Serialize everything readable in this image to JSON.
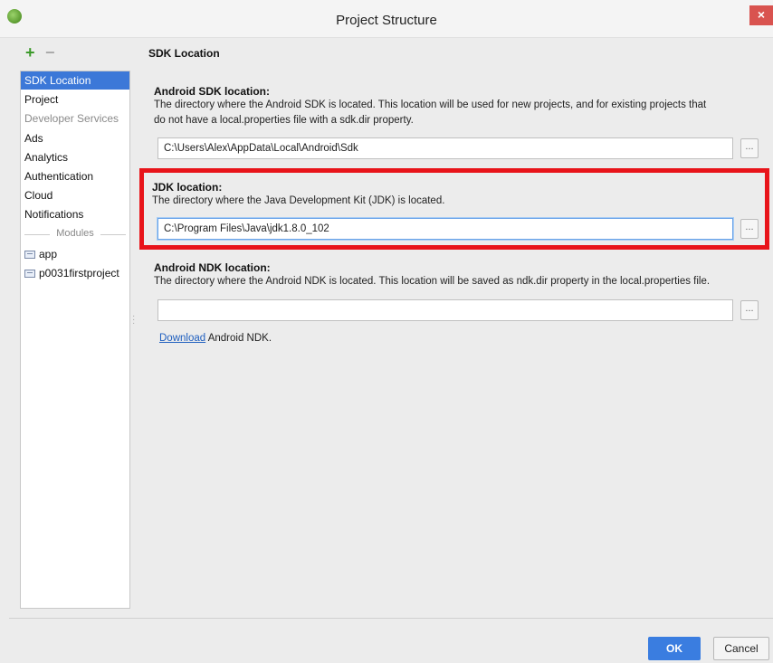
{
  "window": {
    "title": "Project Structure",
    "close_label": "×"
  },
  "toolbar": {
    "add_label": "+",
    "remove_label": "−"
  },
  "sidebar": {
    "items": [
      {
        "label": "SDK Location",
        "selected": true
      },
      {
        "label": "Project"
      },
      {
        "label": "Developer Services",
        "disabled": true
      },
      {
        "label": "Ads"
      },
      {
        "label": "Analytics"
      },
      {
        "label": "Authentication"
      },
      {
        "label": "Cloud"
      },
      {
        "label": "Notifications"
      }
    ],
    "modules_label": "Modules",
    "modules": [
      {
        "label": "app"
      },
      {
        "label": "p0031firstproject"
      }
    ]
  },
  "main": {
    "heading": "SDK Location",
    "android_sdk": {
      "title": "Android SDK location:",
      "description_line1": "The directory where the Android SDK is located. This location will be used for new projects, and for existing projects that",
      "description_line2": "do not have a local.properties file with a sdk.dir property.",
      "value": "C:\\Users\\Alex\\AppData\\Local\\Android\\Sdk",
      "browse_label": "..."
    },
    "jdk": {
      "title": "JDK location:",
      "description": "The directory where the Java Development Kit (JDK) is located.",
      "value": "C:\\Program Files\\Java\\jdk1.8.0_102",
      "browse_label": "..."
    },
    "android_ndk": {
      "title": "Android NDK location:",
      "description": "The directory where the Android NDK is located. This location will be saved as ndk.dir property in the local.properties file.",
      "value": "",
      "browse_label": "...",
      "download_link": "Download",
      "download_suffix": "Android NDK."
    }
  },
  "footer": {
    "ok_label": "OK",
    "cancel_label": "Cancel"
  },
  "colors": {
    "selection": "#3c78d8",
    "highlight": "#e8141a",
    "ok_button": "#3a7de0",
    "link": "#1f5fbf"
  }
}
